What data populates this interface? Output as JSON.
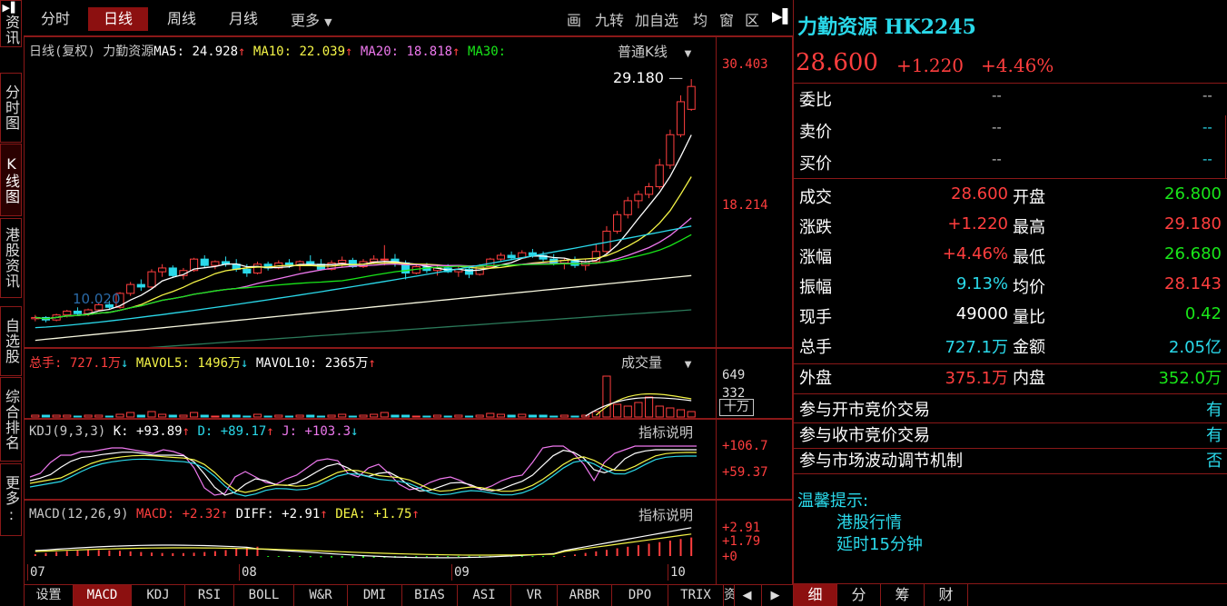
{
  "left_tabs": [
    {
      "icon": "▶▌",
      "label": "资讯"
    },
    {
      "label": "分时图"
    },
    {
      "label": "K线图"
    },
    {
      "label": "港股资讯"
    },
    {
      "label": "自选股"
    },
    {
      "label": "综合排名"
    },
    {
      "label": "更多:"
    }
  ],
  "top": {
    "tabs": [
      "分时",
      "日线",
      "周线",
      "月线"
    ],
    "active_tab": "日线",
    "more": "更多",
    "tools": [
      "画",
      "九转",
      "加自选",
      "均",
      "窗",
      "区"
    ]
  },
  "kline": {
    "title": "日线(复权)",
    "name": "力勤资源",
    "ma5": "MA5: 24.928",
    "ma10": "MA10: 22.039",
    "ma20": "MA20: 18.818",
    "ma30": "MA30:",
    "mode": "普通K线",
    "y_top": "30.403",
    "y_mid": "18.214",
    "high_label": "29.180",
    "low_label": "10.020"
  },
  "volume": {
    "total": "总手: 727.1万",
    "mavol5": "MAVOL5: 1496万",
    "mavol10": "MAVOL10: 2365万",
    "title": "成交量",
    "y_top": "649",
    "y_mid": "332",
    "unit": "十万"
  },
  "kdj": {
    "name": "KDJ(9,3,3)",
    "k": "K: +93.89",
    "d": "D: +89.17",
    "j": "J: +103.3",
    "help": "指标说明",
    "y_top": "+106.7",
    "y_mid": "+59.37"
  },
  "macd": {
    "name": "MACD(12,26,9)",
    "macd": "MACD: +2.32",
    "diff": "DIFF: +2.91",
    "dea": "DEA: +1.75",
    "help": "指标说明",
    "y1": "+2.91",
    "y2": "+1.79",
    "y3": "+0"
  },
  "x_axis": [
    "07",
    "08",
    "09",
    "10"
  ],
  "bottom_tabs": [
    "设置",
    "MACD",
    "KDJ",
    "RSI",
    "BOLL",
    "W&R",
    "DMI",
    "BIAS",
    "ASI",
    "VR",
    "ARBR",
    "DPO",
    "TRIX",
    "资"
  ],
  "bottom_active": "MACD",
  "right": {
    "name": "力勤资源",
    "code": "HK2245",
    "price": "28.600",
    "change": "+1.220",
    "change_pct": "+4.46%",
    "order": [
      {
        "label": "委比",
        "v1": "--",
        "v2": "--"
      },
      {
        "label": "卖价",
        "v1": "--",
        "v2": "--"
      },
      {
        "label": "买价",
        "v1": "--",
        "v2": "--"
      }
    ],
    "stats": [
      {
        "l1": "成交",
        "v1": "28.600",
        "c1": "red",
        "l2": "开盘",
        "v2": "26.800",
        "c2": "grn"
      },
      {
        "l1": "涨跌",
        "v1": "+1.220",
        "c1": "red",
        "l2": "最高",
        "v2": "29.180",
        "c2": "red"
      },
      {
        "l1": "涨幅",
        "v1": "+4.46%",
        "c1": "red",
        "l2": "最低",
        "v2": "26.680",
        "c2": "grn"
      },
      {
        "l1": "振幅",
        "v1": "9.13%",
        "c1": "cyn",
        "l2": "均价",
        "v2": "28.143",
        "c2": "red"
      },
      {
        "l1": "现手",
        "v1": "49000",
        "c1": "wht",
        "l2": "量比",
        "v2": "0.42",
        "c2": "grn"
      },
      {
        "l1": "总手",
        "v1": "727.1万",
        "c1": "cyn",
        "l2": "金额",
        "v2": "2.05亿",
        "c2": "cyn"
      }
    ],
    "outer": {
      "l1": "外盘",
      "v1": "375.1万",
      "l2": "内盘",
      "v2": "352.0万"
    },
    "auction": [
      {
        "label": "参与开市竞价交易",
        "value": "有"
      },
      {
        "label": "参与收市竞价交易",
        "value": "有"
      },
      {
        "label": "参与市场波动调节机制",
        "value": "否"
      }
    ],
    "tip_title": "温馨提示:",
    "tip_lines": [
      "港股行情",
      "延时15分钟"
    ],
    "bottom_tabs": [
      "细",
      "分",
      "筹",
      "财"
    ]
  },
  "chart_data": {
    "type": "candlestick",
    "title": "力勤资源 日线(复权)",
    "x_months": [
      "07",
      "08",
      "09",
      "10"
    ],
    "ylim": [
      9.5,
      30.403
    ],
    "last": {
      "open": 26.8,
      "high": 29.18,
      "low": 26.68,
      "close": 28.6
    },
    "period_high": 29.18,
    "period_low": 10.02,
    "candles": [
      [
        10.3,
        10.6,
        10.1,
        10.4
      ],
      [
        10.4,
        10.5,
        10.02,
        10.2
      ],
      [
        10.2,
        10.7,
        10.1,
        10.6
      ],
      [
        10.6,
        11.0,
        10.4,
        10.9
      ],
      [
        10.9,
        11.2,
        10.6,
        10.7
      ],
      [
        10.7,
        11.1,
        10.5,
        11.0
      ],
      [
        11.0,
        11.6,
        10.9,
        11.4
      ],
      [
        11.4,
        11.7,
        11.0,
        11.2
      ],
      [
        11.2,
        12.4,
        11.1,
        12.3
      ],
      [
        12.3,
        13.2,
        12.1,
        13.0
      ],
      [
        13.0,
        13.4,
        12.5,
        12.8
      ],
      [
        12.8,
        14.2,
        12.7,
        14.0
      ],
      [
        14.0,
        14.6,
        13.6,
        14.3
      ],
      [
        14.3,
        14.5,
        13.5,
        13.7
      ],
      [
        13.7,
        14.3,
        13.4,
        14.1
      ],
      [
        14.1,
        15.1,
        14.0,
        15.0
      ],
      [
        15.0,
        15.3,
        14.3,
        14.5
      ],
      [
        14.5,
        14.9,
        14.2,
        14.8
      ],
      [
        14.8,
        15.2,
        14.4,
        14.6
      ],
      [
        14.6,
        15.0,
        14.0,
        14.2
      ],
      [
        14.2,
        14.6,
        13.6,
        13.9
      ],
      [
        13.9,
        14.8,
        13.8,
        14.6
      ],
      [
        14.6,
        14.8,
        14.1,
        14.3
      ],
      [
        14.3,
        14.9,
        14.2,
        14.7
      ],
      [
        14.7,
        15.0,
        14.3,
        14.5
      ],
      [
        14.5,
        14.9,
        14.1,
        14.8
      ],
      [
        14.8,
        15.3,
        14.5,
        14.6
      ],
      [
        14.6,
        15.0,
        14.1,
        14.2
      ],
      [
        14.2,
        14.9,
        14.1,
        14.7
      ],
      [
        14.7,
        15.2,
        14.4,
        14.9
      ],
      [
        14.9,
        15.1,
        14.3,
        14.4
      ],
      [
        14.4,
        15.0,
        14.3,
        14.8
      ],
      [
        14.8,
        15.3,
        14.6,
        15.0
      ],
      [
        15.0,
        16.1,
        14.5,
        15.0
      ],
      [
        15.0,
        15.4,
        14.4,
        14.7
      ],
      [
        14.7,
        14.9,
        13.4,
        13.9
      ],
      [
        13.9,
        14.6,
        13.8,
        14.4
      ],
      [
        14.4,
        14.7,
        13.9,
        14.1
      ],
      [
        14.1,
        14.5,
        13.7,
        14.3
      ],
      [
        14.3,
        14.6,
        13.9,
        14.0
      ],
      [
        14.0,
        14.5,
        13.6,
        14.2
      ],
      [
        14.2,
        14.4,
        13.5,
        13.8
      ],
      [
        13.8,
        14.6,
        13.7,
        14.4
      ],
      [
        14.4,
        15.1,
        14.3,
        15.0
      ],
      [
        15.0,
        15.5,
        14.8,
        15.3
      ],
      [
        15.3,
        15.6,
        14.9,
        15.1
      ],
      [
        15.1,
        15.7,
        15.0,
        15.5
      ],
      [
        15.5,
        15.8,
        15.1,
        15.3
      ],
      [
        15.3,
        15.6,
        14.8,
        15.0
      ],
      [
        15.0,
        15.4,
        14.5,
        14.7
      ],
      [
        14.7,
        15.1,
        14.2,
        14.9
      ],
      [
        14.9,
        15.2,
        14.3,
        14.5
      ],
      [
        14.5,
        15.0,
        14.1,
        14.8
      ],
      [
        14.8,
        16.2,
        14.7,
        15.6
      ],
      [
        15.6,
        17.6,
        15.4,
        17.2
      ],
      [
        17.2,
        18.8,
        17.0,
        18.5
      ],
      [
        18.5,
        19.9,
        18.2,
        19.6
      ],
      [
        19.6,
        20.4,
        19.0,
        20.1
      ],
      [
        20.1,
        21.0,
        19.8,
        20.7
      ],
      [
        20.7,
        22.9,
        20.5,
        22.4
      ],
      [
        22.4,
        25.2,
        22.1,
        24.8
      ],
      [
        24.8,
        27.9,
        24.6,
        27.4
      ],
      [
        26.8,
        29.18,
        26.68,
        28.6
      ]
    ],
    "series": [
      {
        "name": "MA5",
        "color": "#ffffff",
        "value": 24.928
      },
      {
        "name": "MA10",
        "color": "#f5f547",
        "value": 22.039
      },
      {
        "name": "MA20",
        "color": "#ee78ee",
        "value": 18.818
      },
      {
        "name": "MA30",
        "color": "#19e619",
        "value": null
      }
    ],
    "volume": {
      "ylim": [
        0,
        649
      ],
      "unit": "十万",
      "mavol5": "1496万",
      "mavol10": "2365万"
    },
    "kdj": {
      "ylim_labels": [
        "+106.7",
        "+59.37"
      ],
      "k": 93.89,
      "d": 89.17,
      "j": 103.3
    },
    "macd": {
      "diff": 2.91,
      "dea": 1.75,
      "macd": 2.32
    }
  }
}
